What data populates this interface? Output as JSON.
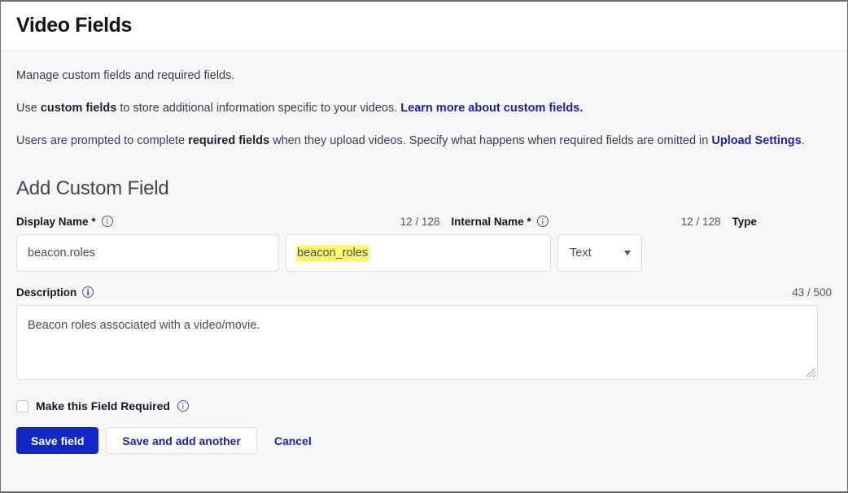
{
  "header": {
    "title": "Video Fields"
  },
  "intro": {
    "line1": "Manage custom fields and required fields.",
    "line2_pre": "Use ",
    "line2_bold": "custom fields",
    "line2_mid": " to store additional information specific to your videos. ",
    "line2_link": "Learn more about custom fields.",
    "line3_pre": "Users are prompted to complete ",
    "line3_bold": "required fields",
    "line3_mid": " when they upload videos. Specify what happens when required fields are omitted in ",
    "line3_link": "Upload Settings",
    "line3_post": "."
  },
  "section": {
    "title": "Add Custom Field"
  },
  "form": {
    "display_name": {
      "label": "Display Name *",
      "counter": "12 / 128",
      "value": "beacon.roles",
      "info_icon": "info-circle-icon"
    },
    "internal_name": {
      "label": "Internal Name *",
      "counter": "12 / 128",
      "value": "beacon_roles",
      "highlight_color": "#fffa6e",
      "info_icon": "info-circle-icon"
    },
    "type": {
      "label": "Type",
      "value": "Text",
      "caret_icon": "chevron-down-icon"
    },
    "description": {
      "label": "Description",
      "counter": "43 / 500",
      "value": "Beacon roles associated with a video/movie.",
      "info_icon": "info-circle-icon",
      "resize_icon": "resize-grip-icon"
    },
    "required_checkbox": {
      "label": "Make this Field Required",
      "checked": false,
      "info_icon": "info-circle-icon"
    }
  },
  "actions": {
    "save": "Save field",
    "save_and_add": "Save and add another",
    "cancel": "Cancel"
  },
  "colors": {
    "primary": "#1227c6",
    "link": "#1c1fa6",
    "highlight": "#fffa6e",
    "page_bg": "#f7f7f8"
  }
}
